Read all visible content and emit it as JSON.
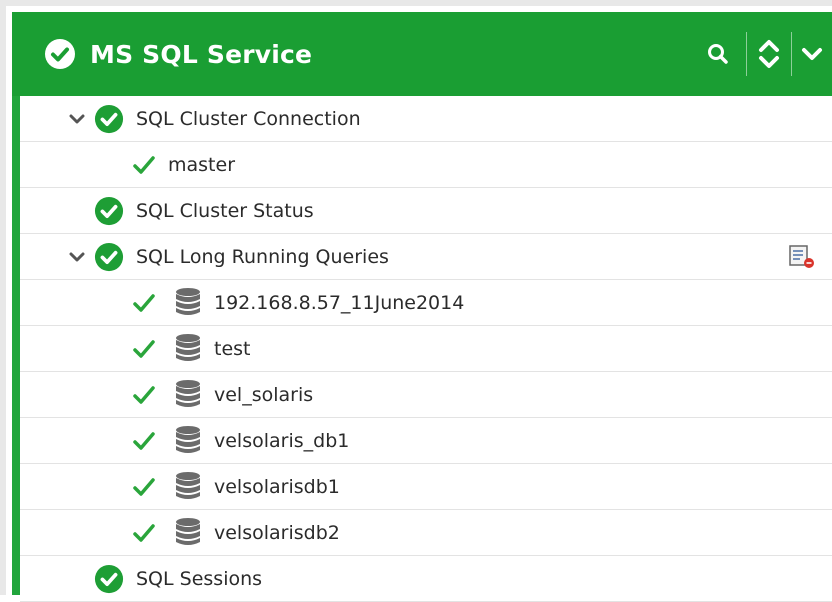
{
  "panel": {
    "title": "MS SQL Service",
    "header_icons": [
      "check-circle-icon",
      "search-icon",
      "sort-icon",
      "chevron-down-icon"
    ]
  },
  "colors": {
    "header_green": "#1a9e33",
    "status_green": "#1e9e35",
    "check_green": "#2aa53b",
    "db_gray": "#6b6b6b"
  },
  "tree": {
    "cluster_connection": {
      "label": "SQL Cluster Connection",
      "expanded": true,
      "status": "ok",
      "children": [
        {
          "label": "master",
          "status": "ok"
        }
      ]
    },
    "cluster_status": {
      "label": "SQL Cluster Status",
      "status": "ok"
    },
    "long_running": {
      "label": "SQL Long Running Queries",
      "expanded": true,
      "status": "ok",
      "action_icon": "edit-report-icon",
      "children": [
        {
          "label": "192.168.8.57_11June2014",
          "status": "ok",
          "icon": "database-icon"
        },
        {
          "label": "test",
          "status": "ok",
          "icon": "database-icon"
        },
        {
          "label": "vel_solaris",
          "status": "ok",
          "icon": "database-icon"
        },
        {
          "label": "velsolaris_db1",
          "status": "ok",
          "icon": "database-icon"
        },
        {
          "label": "velsolarisdb1",
          "status": "ok",
          "icon": "database-icon"
        },
        {
          "label": "velsolarisdb2",
          "status": "ok",
          "icon": "database-icon"
        }
      ]
    },
    "sessions": {
      "label": "SQL Sessions",
      "status": "ok"
    }
  }
}
